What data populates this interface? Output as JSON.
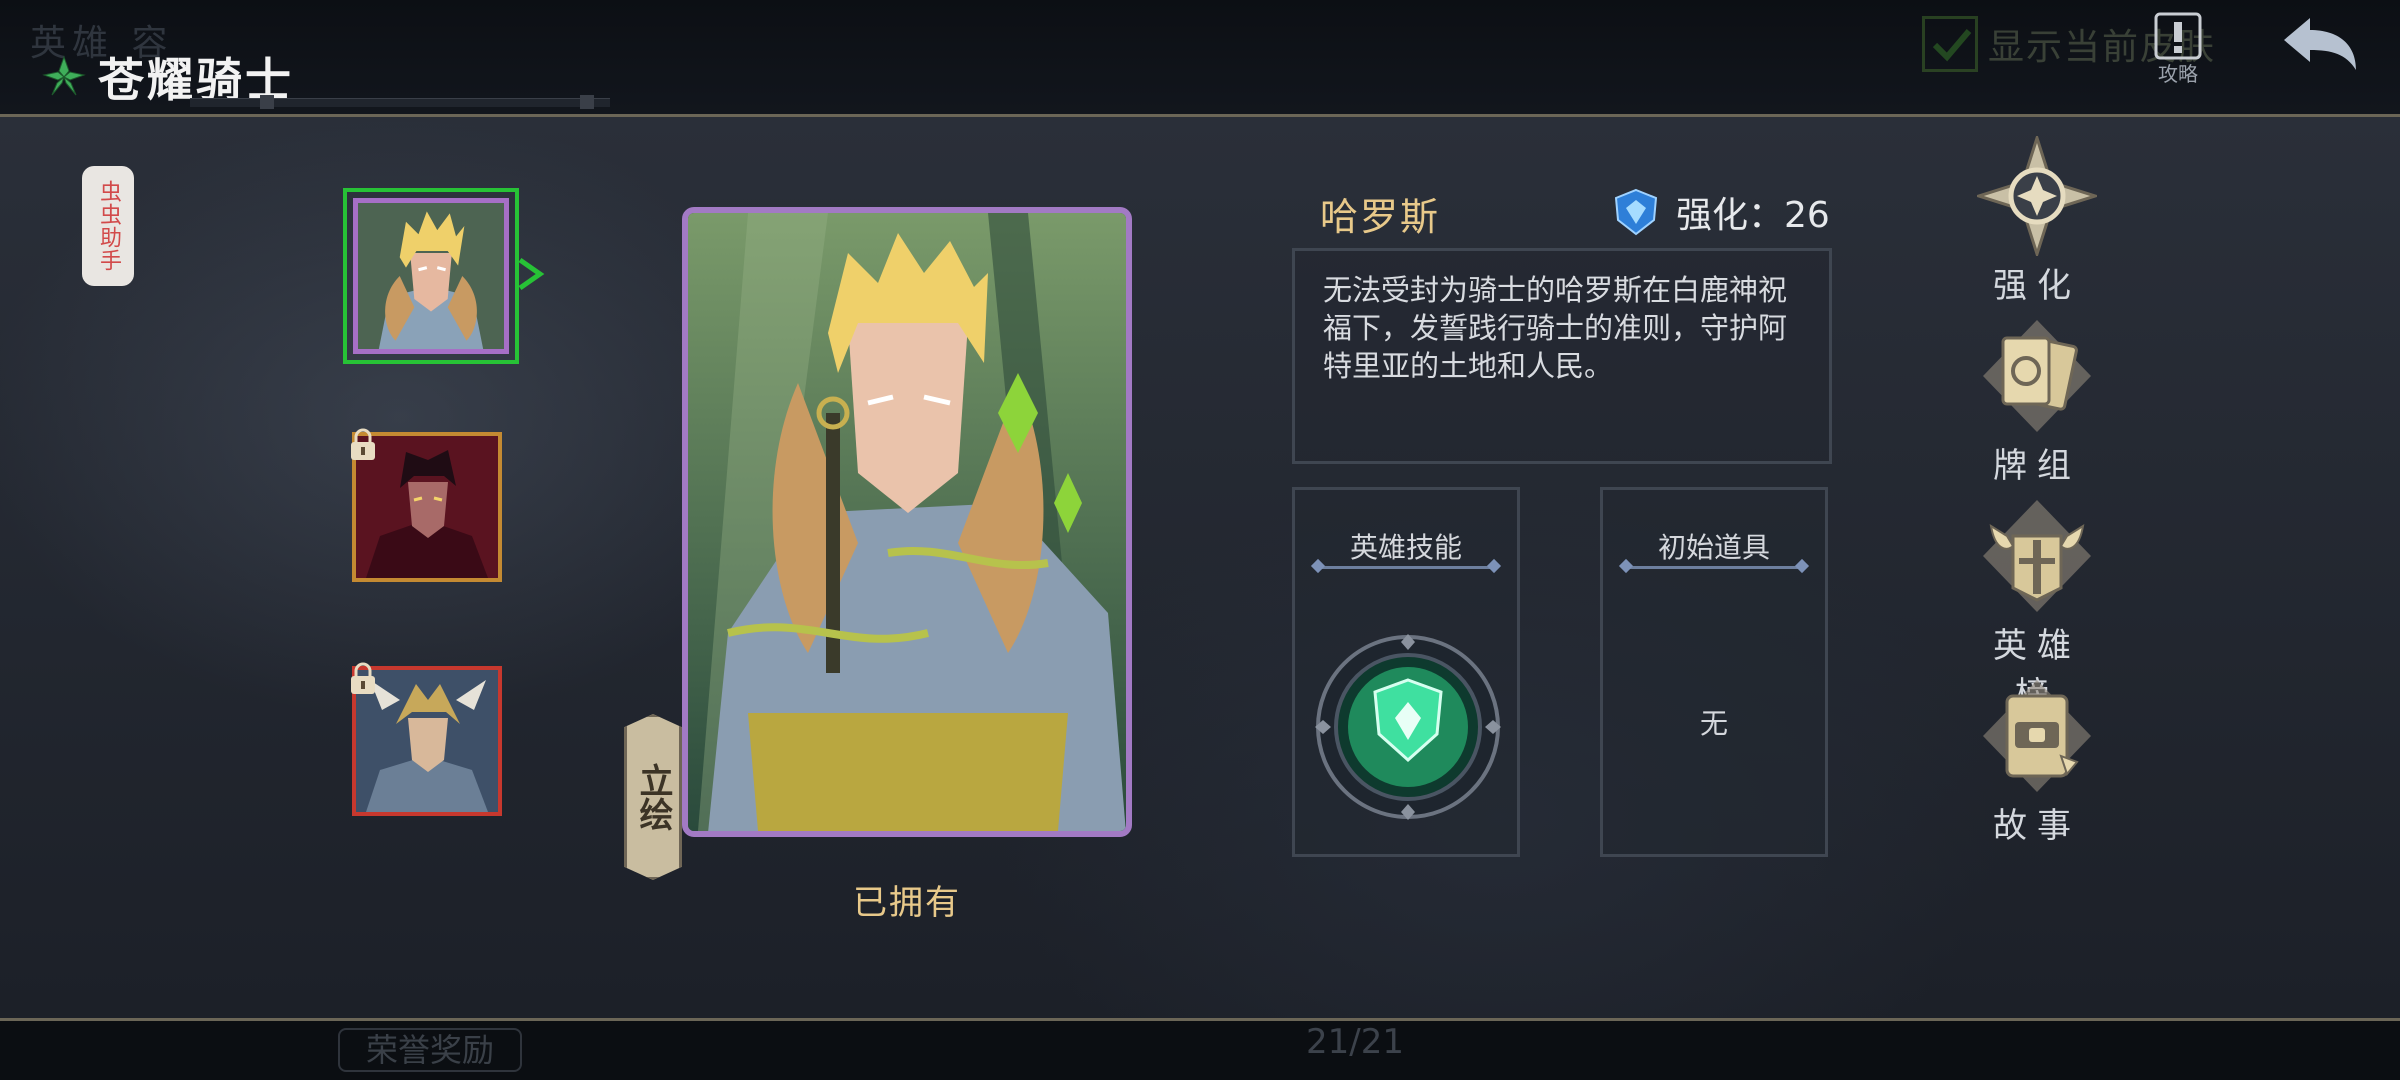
{
  "header": {
    "ghost_tabs": "英雄   容",
    "title": "苍耀骑士",
    "show_skin_label": "显示当前皮肤",
    "guide_label": "攻略"
  },
  "side": {
    "helper_label": "虫虫助手"
  },
  "hero": {
    "name": "哈罗斯",
    "upgrade_label": "强化：26",
    "description": "无法受封为骑士的哈罗斯在白鹿神祝福下，发誓践行骑士的准则，守护阿特里亚的土地和人民。",
    "art_button": "立绘",
    "status": "已拥有",
    "skill_title": "英雄技能",
    "item_title": "初始道具",
    "item_value": "无"
  },
  "menu": [
    {
      "label": "强化",
      "icon": "compass-star-icon"
    },
    {
      "label": "牌组",
      "icon": "card-deck-icon"
    },
    {
      "label": "英雄榜",
      "icon": "horned-helmet-icon"
    },
    {
      "label": "故事",
      "icon": "story-book-icon"
    }
  ],
  "footer": {
    "honor_label": "荣誉奖励",
    "page_count": "21/21"
  },
  "colors": {
    "accent_gold": "#e8c98a",
    "selected_green": "#27c236",
    "frame_purple": "#a27ac4"
  }
}
